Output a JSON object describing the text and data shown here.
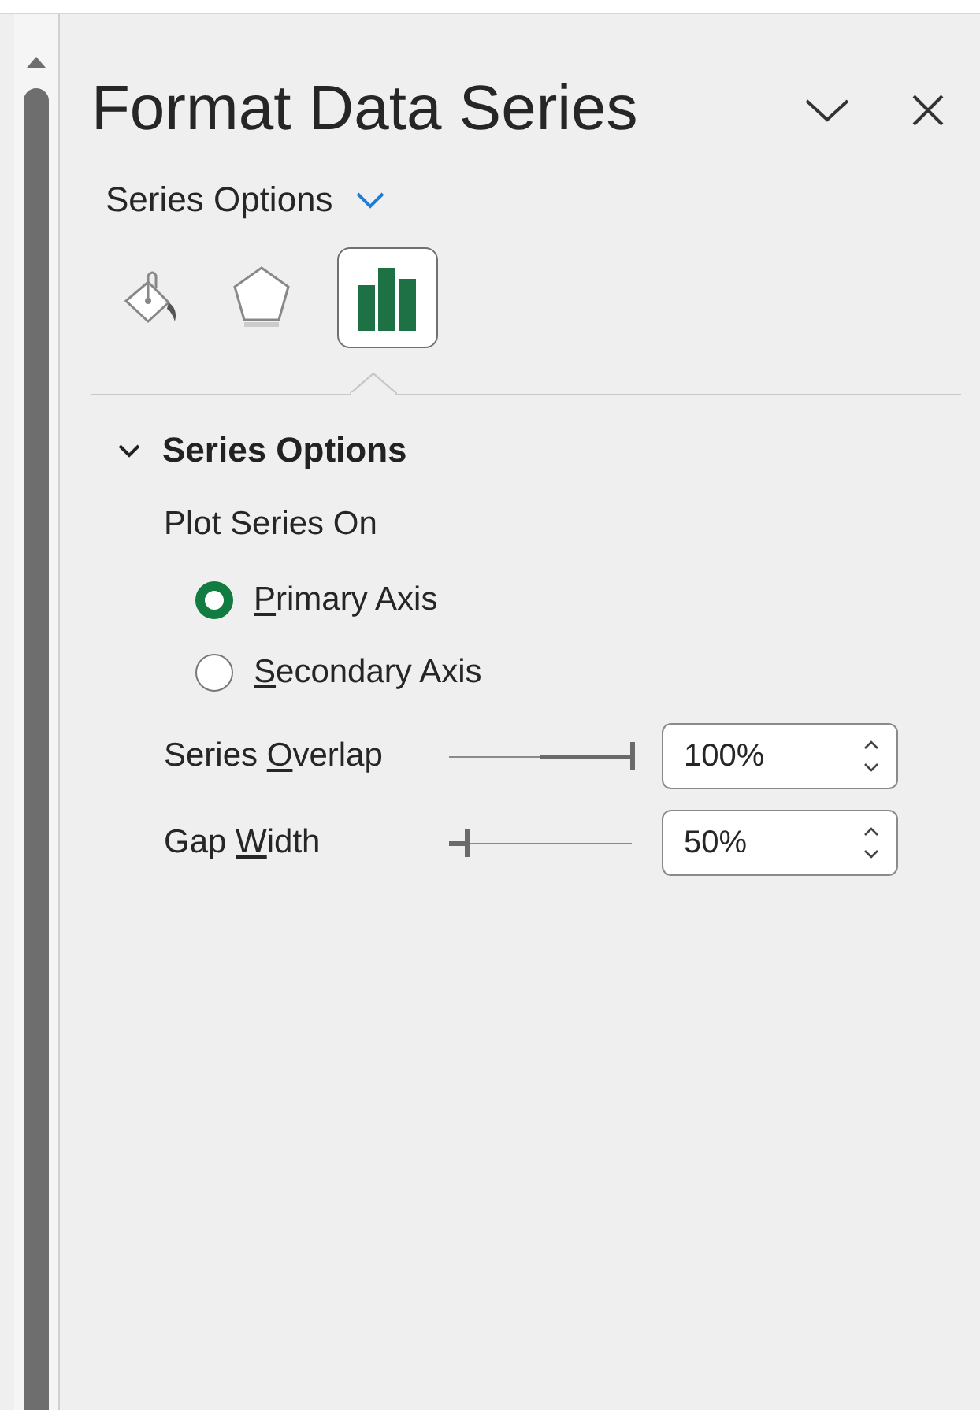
{
  "pane": {
    "title": "Format Data Series"
  },
  "options_menu": {
    "label": "Series Options"
  },
  "tabs": [
    {
      "kind": "fill",
      "selected": false
    },
    {
      "kind": "effects",
      "selected": false
    },
    {
      "kind": "series",
      "selected": true
    }
  ],
  "section": {
    "title": "Series Options",
    "expanded": true,
    "subtitle": "Plot Series On",
    "radios": [
      {
        "label": {
          "key": "P",
          "rest": "rimary Axis"
        },
        "selected": true
      },
      {
        "label": {
          "key": "S",
          "rest": "econdary Axis"
        },
        "selected": false
      }
    ],
    "sliders": [
      {
        "kind": "centered",
        "label": {
          "lead": "Series ",
          "key": "O",
          "rest": "verlap"
        },
        "level": 1.0,
        "value": "100%"
      },
      {
        "kind": "plain",
        "label": {
          "lead": "Gap ",
          "key": "W",
          "rest": "idth"
        },
        "level": 0.1,
        "value": "50%"
      }
    ]
  }
}
